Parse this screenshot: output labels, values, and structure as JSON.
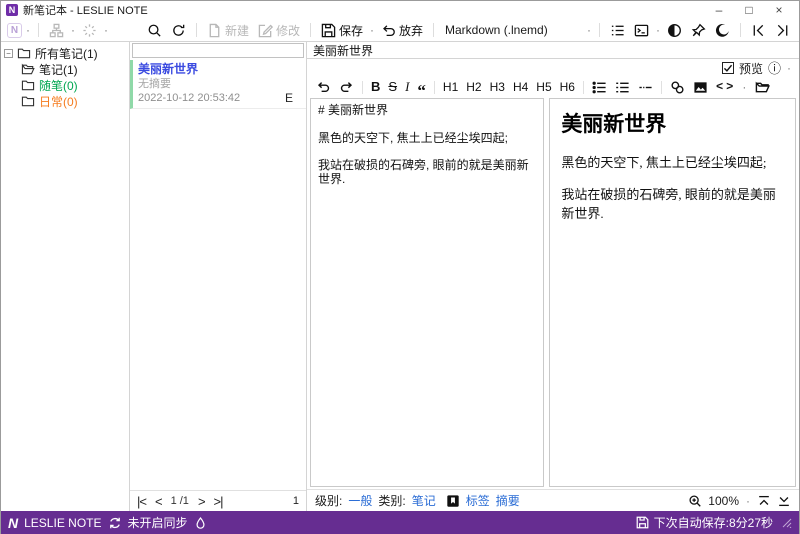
{
  "window": {
    "title": "新笔记本 - LESLIE NOTE",
    "logo_letter": "N",
    "minimize": "–",
    "maximize": "□",
    "close": "×"
  },
  "ui": {
    "dot": "·"
  },
  "toolbar": {
    "new_label": "新建",
    "modify_label": "修改",
    "save_label": "保存",
    "discard_label": "放弃",
    "format_select": "Markdown (.lnemd)"
  },
  "sidebar": {
    "items": [
      {
        "label": "所有笔记(1)",
        "expander": "−"
      },
      {
        "label": "笔记(1)"
      },
      {
        "label": "随笔(0)"
      },
      {
        "label": "日常(0)"
      }
    ]
  },
  "colors": {
    "accent_purple": "#662d91",
    "note_title_blue": "#3a4ae0",
    "category_green": "#00a651",
    "category_orange": "#f57c1f",
    "link_blue": "#2a6cd5",
    "selected_bar_green": "#8fd9a8"
  },
  "notelist": {
    "note": {
      "title": "美丽新世界",
      "summary": "无摘要",
      "date": "2022-10-12 20:53:42",
      "badge": "E"
    },
    "pagination": {
      "first": "|<",
      "prev": "<",
      "page": "1",
      "total": "/1",
      "next": ">",
      "last": ">|",
      "count": "1"
    }
  },
  "editor": {
    "title": "美丽新世界",
    "preview_label": "预览",
    "info_glyph": "ⓘ",
    "fmt": {
      "bold": "B",
      "strike": "S",
      "italic": "I",
      "quote": "“",
      "lt": "<",
      "gt": ">"
    },
    "h": [
      "H1",
      "H2",
      "H3",
      "H4",
      "H5",
      "H6"
    ],
    "source": "# 美丽新世界\n\n黑色的天空下, 焦土上已经尘埃四起;\n\n我站在破损的石碑旁, 眼前的就是美丽新世界.",
    "preview": {
      "heading": "美丽新世界",
      "para1": "黑色的天空下, 焦土上已经尘埃四起;",
      "para2": "我站在破损的石碑旁, 眼前的就是美丽新世界."
    },
    "bottom": {
      "level_label": "级别:",
      "level_value": "一般",
      "category_label": "类别:",
      "category_value": "笔记",
      "tags_label": "标签",
      "summary_label": "摘要",
      "zoom_value": "100%"
    }
  },
  "statusbar": {
    "logo_letter": "N",
    "app_name": "LESLIE NOTE",
    "sync_status": "未开启同步",
    "autosave": "下次自动保存:8分27秒"
  }
}
